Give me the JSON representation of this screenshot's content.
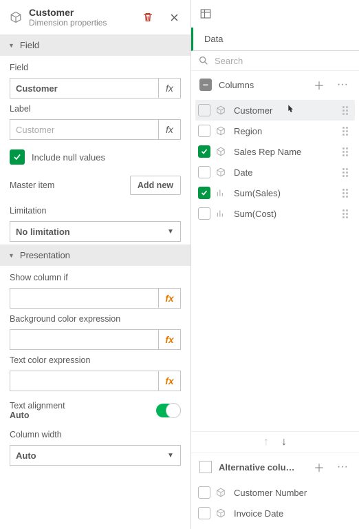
{
  "header": {
    "title": "Customer",
    "subtitle": "Dimension properties"
  },
  "sections": {
    "field": "Field",
    "presentation": "Presentation"
  },
  "field": {
    "field_label": "Field",
    "field_value": "Customer",
    "label_label": "Label",
    "label_placeholder": "Customer",
    "include_null_label": "Include null values",
    "include_null_checked": true,
    "master_item_label": "Master item",
    "add_new_label": "Add new",
    "limitation_label": "Limitation",
    "limitation_value": "No limitation"
  },
  "presentation": {
    "show_if_label": "Show column if",
    "show_if_value": "",
    "bg_expr_label": "Background color expression",
    "bg_expr_value": "",
    "text_expr_label": "Text color expression",
    "text_expr_value": "",
    "text_align_label": "Text alignment",
    "text_align_value": "Auto",
    "col_width_label": "Column width",
    "col_width_value": "Auto"
  },
  "fx_glyph": "fx",
  "right": {
    "tab_label": "Data",
    "search_placeholder": "Search",
    "columns_label": "Columns",
    "columns": [
      {
        "label": "Customer",
        "checked": false,
        "kind": "cube",
        "selected": true,
        "cursor": true
      },
      {
        "label": "Region",
        "checked": false,
        "kind": "cube"
      },
      {
        "label": "Sales Rep Name",
        "checked": true,
        "kind": "cube"
      },
      {
        "label": "Date",
        "checked": false,
        "kind": "cube"
      },
      {
        "label": "Sum(Sales)",
        "checked": true,
        "kind": "bar"
      },
      {
        "label": "Sum(Cost)",
        "checked": false,
        "kind": "bar"
      }
    ],
    "alt_label": "Alternative colu…",
    "alt_items": [
      {
        "label": "Customer Number",
        "checked": false,
        "kind": "cube"
      },
      {
        "label": "Invoice Date",
        "checked": false,
        "kind": "cube"
      }
    ]
  }
}
